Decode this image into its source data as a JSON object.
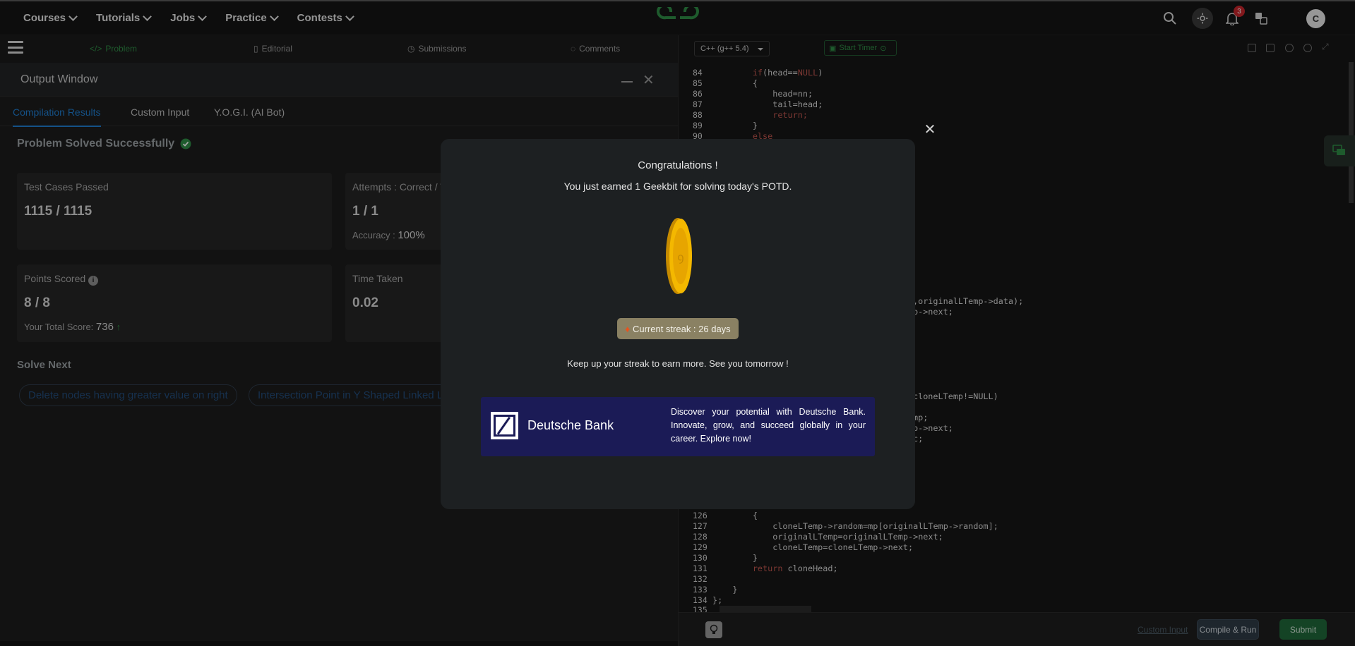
{
  "nav": {
    "menu": [
      "Courses",
      "Tutorials",
      "Jobs",
      "Practice",
      "Contests"
    ],
    "notification_count": "3",
    "avatar_initial": "C"
  },
  "problem_tabs": [
    "Problem",
    "Editorial",
    "Submissions",
    "Comments"
  ],
  "output": {
    "title": "Output Window",
    "tabs": [
      "Compilation Results",
      "Custom Input",
      "Y.O.G.I. (AI Bot)"
    ],
    "status": "Problem Solved Successfully",
    "cards": {
      "test_cases_label": "Test Cases Passed",
      "test_cases_value": "1115 / 1115",
      "attempts_label": "Attempts : Correct / Total",
      "attempts_value": "1 / 1",
      "accuracy_label": "Accuracy :",
      "accuracy_value": "100%",
      "points_label": "Points Scored",
      "points_value": "8 / 8",
      "total_score_label": "Your Total Score:",
      "total_score_value": "736",
      "time_label": "Time Taken",
      "time_value": "0.02"
    },
    "solve_next_label": "Solve Next",
    "solve_next": [
      "Delete nodes having greater value on right",
      "Intersection Point in Y Shaped Linked Lists"
    ]
  },
  "editor": {
    "language": "C++ (g++ 5.4)",
    "timer_label": "Start Timer",
    "custom_input": "Custom Input",
    "compile_run": "Compile & Run",
    "submit": "Submit",
    "lines_top": [
      {
        "n": "84",
        "code": "        if(head==NULL)"
      },
      {
        "n": "85",
        "code": "        {"
      },
      {
        "n": "86",
        "code": "            head=nn;"
      },
      {
        "n": "87",
        "code": "            tail=head;"
      },
      {
        "n": "88",
        "code": "            return;"
      },
      {
        "n": "89",
        "code": "        }"
      },
      {
        "n": "90",
        "code": "        else"
      }
    ],
    "frag_1": ",originalLTemp->data);",
    "frag_2": "p->next;",
    "frag_3": "cloneLTemp!=NULL)",
    "frag_4": "mp;",
    "frag_5": "p->next;",
    "frag_6": "c;",
    "lines_bottom": [
      {
        "n": "126",
        "code": "        {"
      },
      {
        "n": "127",
        "code": "            cloneLTemp->random=mp[originalLTemp->random];"
      },
      {
        "n": "128",
        "code": "            originalLTemp=originalLTemp->next;"
      },
      {
        "n": "129",
        "code": "            cloneLTemp=cloneLTemp->next;"
      },
      {
        "n": "130",
        "code": "        }"
      },
      {
        "n": "131",
        "code": "        return cloneHead;"
      },
      {
        "n": "132",
        "code": ""
      },
      {
        "n": "133",
        "code": "    }"
      },
      {
        "n": "134",
        "code": "};"
      },
      {
        "n": "135",
        "code": ""
      }
    ]
  },
  "modal": {
    "title": "Congratulations !",
    "earned": "You just earned 1 Geekbit for solving today's POTD.",
    "streak": "Current streak : 26 days",
    "keep_up": "Keep up your streak to earn more. See you tomorrow !",
    "ad_brand": "Deutsche Bank",
    "ad_text": "Discover your potential with Deutsche Bank. Innovate, grow, and succeed globally in your career. Explore now!"
  },
  "colors": {
    "accent_green": "#2f8d46",
    "link_blue": "#1f7dcf",
    "ad_background": "#1b1b56"
  }
}
